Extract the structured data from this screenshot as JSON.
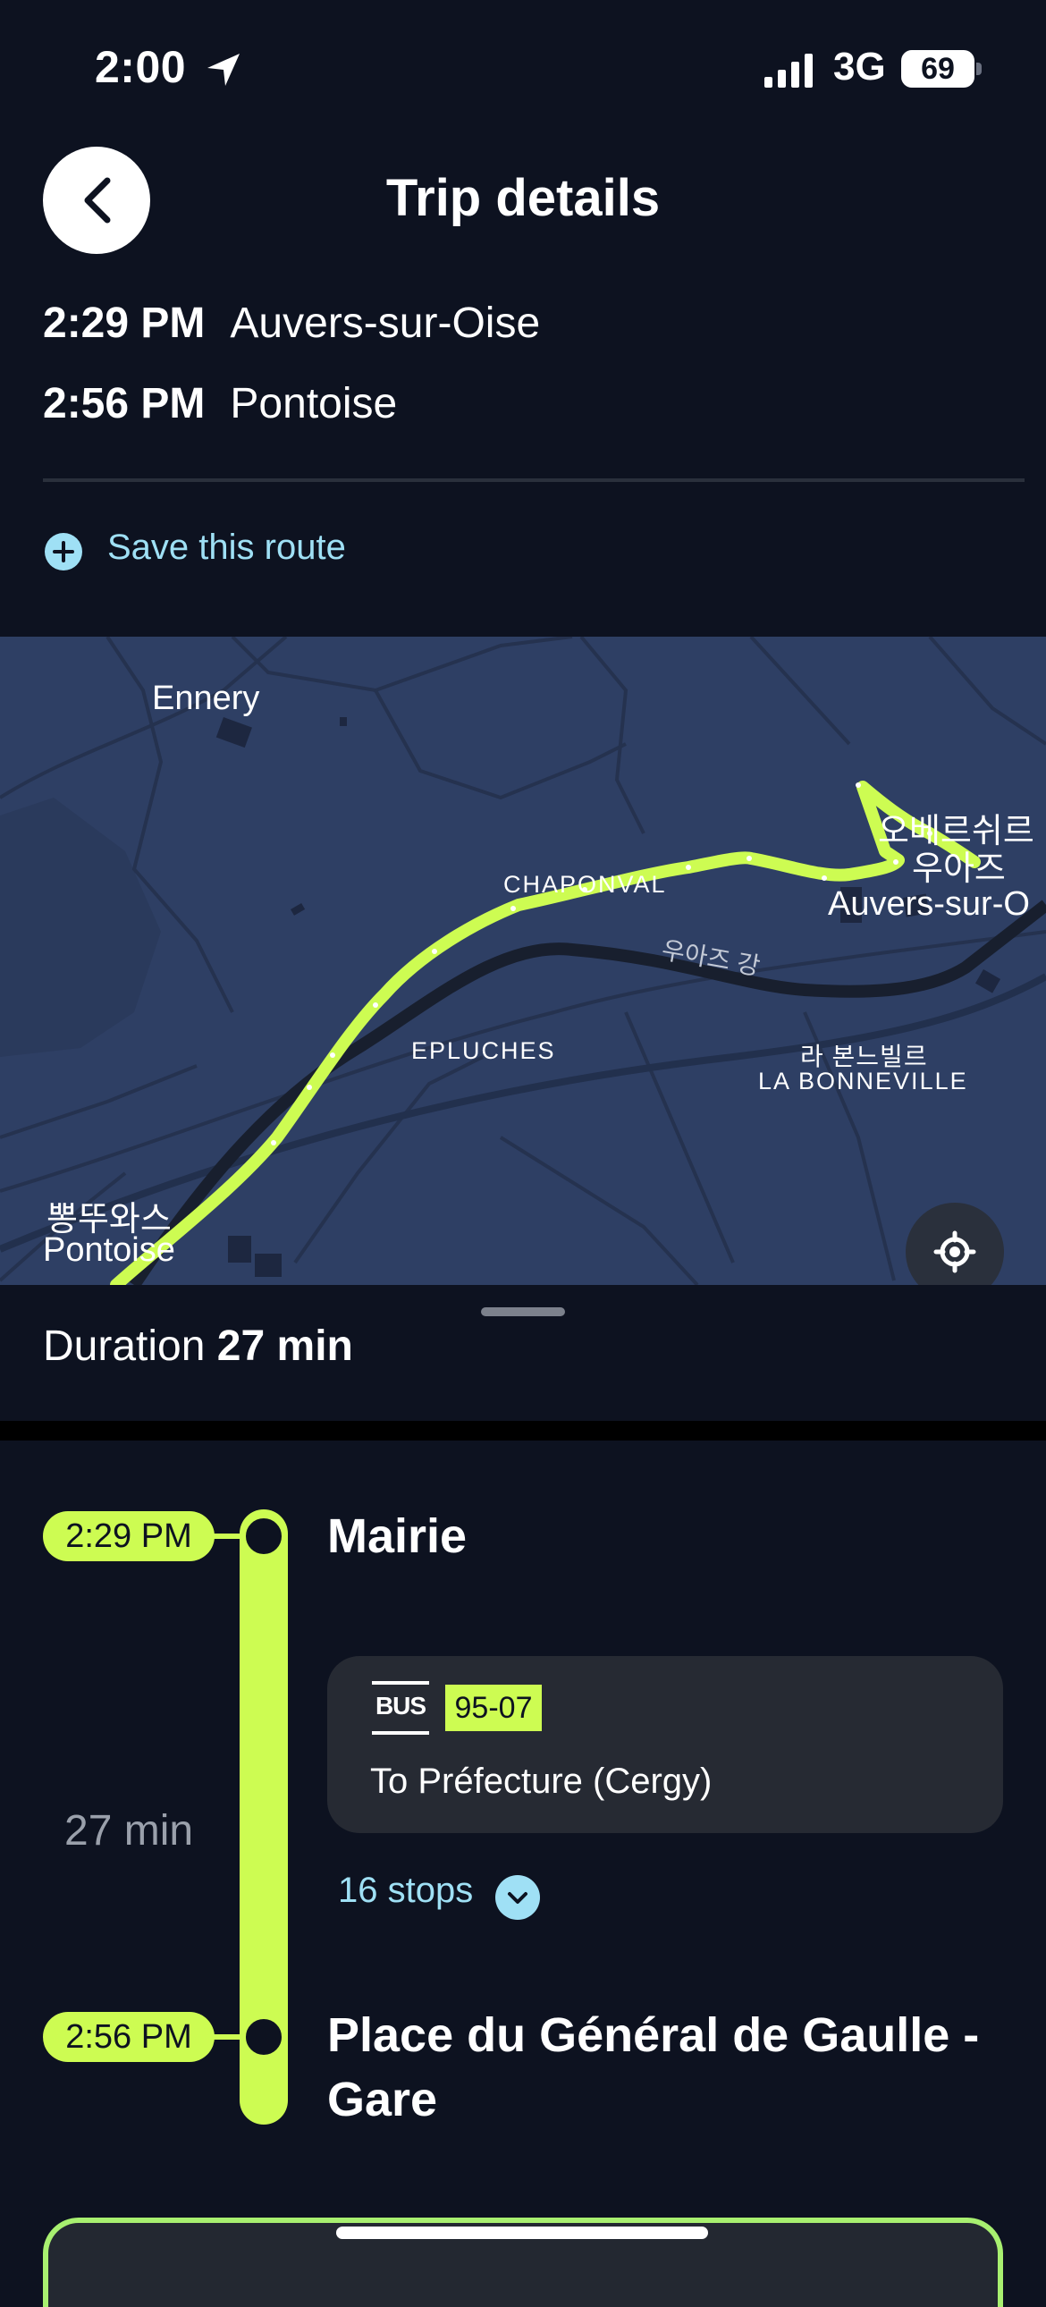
{
  "status_bar": {
    "time": "2:00",
    "network": "3G",
    "battery": "69",
    "location_icon": "location-arrow-icon",
    "signal_icon": "signal-bars-icon"
  },
  "header": {
    "title": "Trip details",
    "back_icon": "chevron-left-icon"
  },
  "trip": {
    "departure": {
      "time": "2:29 PM",
      "place": "Auvers-sur-Oise"
    },
    "arrival": {
      "time": "2:56 PM",
      "place": "Pontoise"
    }
  },
  "save_route": {
    "label": "Save this route",
    "icon": "plus-circle-icon"
  },
  "map": {
    "labels": {
      "ennery": "Ennery",
      "chaponval": "CHAPONVAL",
      "auvers_kr1": "오베르쉬르",
      "auvers_kr2": "우아즈",
      "auvers": "Auvers-sur-O",
      "river": "우아즈 강",
      "epluches": "EPLUCHES",
      "bonneville_kr": "라 본느빌르",
      "bonneville": "LA BONNEVILLE",
      "pontoise_kr": "뽕뚜와스",
      "pontoise": "Pontoise"
    },
    "locate_icon": "crosshair-icon",
    "route_color": "#cdfc52"
  },
  "duration": {
    "label": "Duration",
    "value": "27 min"
  },
  "itinerary": {
    "start": {
      "time": "2:29 PM",
      "stop": "Mairie"
    },
    "end": {
      "time": "2:56 PM",
      "stop": "Place du Général de Gaulle - Gare"
    },
    "travel_time": "27 min",
    "leg": {
      "mode": "BUS",
      "line": "95-07",
      "direction": "To Préfecture (Cergy)",
      "stops": "16 stops",
      "expand_icon": "chevron-down-icon"
    }
  },
  "colors": {
    "background": "#0d1220",
    "accent": "#cdfc52",
    "link": "#9fe0f5",
    "map_background": "#2e3f64"
  }
}
